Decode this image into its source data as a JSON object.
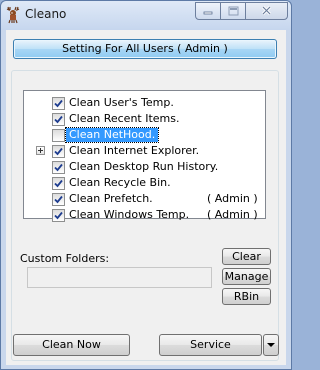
{
  "window": {
    "title": "Cleano"
  },
  "header": {
    "setting_label": "Setting For All Users  ( Admin )"
  },
  "tree": {
    "items": [
      {
        "label": "Clean User's Temp.",
        "checked": true,
        "selected": false,
        "expandable": false,
        "admin": ""
      },
      {
        "label": "Clean Recent Items.",
        "checked": true,
        "selected": false,
        "expandable": false,
        "admin": ""
      },
      {
        "label": "Clean NetHood.",
        "checked": false,
        "selected": true,
        "expandable": false,
        "admin": ""
      },
      {
        "label": "Clean Internet Explorer.",
        "checked": true,
        "selected": false,
        "expandable": true,
        "admin": ""
      },
      {
        "label": "Clean Desktop Run History.",
        "checked": true,
        "selected": false,
        "expandable": false,
        "admin": ""
      },
      {
        "label": "Clean Recycle Bin.",
        "checked": true,
        "selected": false,
        "expandable": false,
        "admin": ""
      },
      {
        "label": "Clean Prefetch.",
        "checked": true,
        "selected": false,
        "expandable": false,
        "admin": "( Admin )"
      },
      {
        "label": "Clean Windows Temp.",
        "checked": true,
        "selected": false,
        "expandable": false,
        "admin": "( Admin )"
      }
    ]
  },
  "custom_folders": {
    "label": "Custom Folders:",
    "value": ""
  },
  "side_buttons": {
    "clear": "Clear",
    "manage": "Manage",
    "rbin": "RBin"
  },
  "footer": {
    "clean_now": "Clean  Now",
    "service": "Service"
  },
  "colors": {
    "selection": "#3399ff",
    "accent_button": "#a8d6f5",
    "close_button": "#cdd8ea"
  },
  "icons": {
    "app": "deer-icon",
    "minimize": "minimize-icon",
    "maximize": "maximize-icon",
    "close": "close-icon",
    "dropdown": "chevron-down-icon"
  }
}
